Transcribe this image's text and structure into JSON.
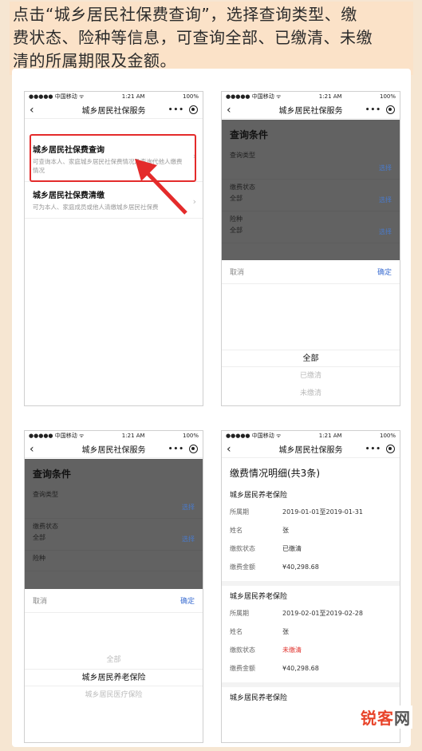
{
  "banner": {
    "line1": "点击“城乡居民社保费查询”，选择查询类型、缴",
    "line2": "费状态、险种等信息，可查询全部、已缴清、未缴",
    "line3": "清的所属期限及金额。"
  },
  "statusbar": {
    "carrier": "●●●●● 中国移动 ᯤ",
    "time": "1:21 AM",
    "battery": "100%"
  },
  "nav": {
    "back": "‹",
    "title": "城乡居民社保服务",
    "more": "•••"
  },
  "screen1": {
    "items": [
      {
        "title": "城乡居民社保费查询",
        "desc": "可查询本人、家庭城乡居民社保费情况及查询代他人缴费情况"
      },
      {
        "title": "城乡居民社保费清缴",
        "desc": "可为本人、家庭成员或他人清缴城乡居民社保费"
      }
    ]
  },
  "query": {
    "title": "查询条件",
    "type_label": "查询类型",
    "status_label": "缴费状态",
    "status_value": "全部",
    "insurance_label": "险种",
    "insurance_value": "全部",
    "select": "选择",
    "cancel": "取消",
    "confirm": "确定"
  },
  "screen2": {
    "options": [
      "全部",
      "已缴清",
      "未缴清"
    ]
  },
  "screen3": {
    "options": [
      "全部",
      "城乡居民养老保险",
      "城乡居民医疗保险"
    ]
  },
  "screen4": {
    "title": "缴费情况明细(共3条)",
    "labels": {
      "period": "所属期",
      "name": "姓名",
      "status": "缴款状态",
      "amount": "缴费金额"
    },
    "records": [
      {
        "insurance": "城乡居民养老保险",
        "period": "2019-01-01至2019-01-31",
        "name": "张",
        "status": "已缴清",
        "amount": "¥40,298.68"
      },
      {
        "insurance": "城乡居民养老保险",
        "period": "2019-02-01至2019-02-28",
        "name": "张",
        "status": "未缴清",
        "amount": "¥40,298.68"
      },
      {
        "insurance": "城乡居民养老保险"
      }
    ]
  },
  "watermark": {
    "part1": "锐客",
    "part2": "网"
  }
}
